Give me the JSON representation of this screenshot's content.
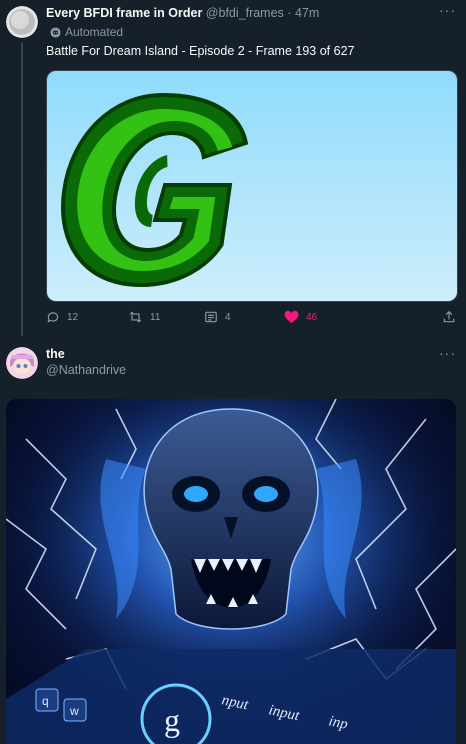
{
  "tweet1": {
    "author_name": "Every BFDI frame in Order",
    "handle": "@bfdi_frames",
    "separator": "·",
    "time": "47m",
    "automated_label": "Automated",
    "text": "Battle For Dream Island - Episode 2 - Frame 193 of 627",
    "media_letter": "G",
    "replies": "12",
    "retweets": "11",
    "quotes": "4",
    "likes": "46",
    "more": "···"
  },
  "tweet2": {
    "author_name": "the",
    "handle": "@Nathandrive",
    "more": "···",
    "media_text_1": "nput",
    "media_text_2": "input",
    "media_text_3": "inp",
    "media_key_1": "q",
    "media_key_2": "w",
    "media_logo": "g"
  },
  "colors": {
    "background": "#15202b",
    "like": "#f91880",
    "secondary_text": "#8b98a5"
  }
}
